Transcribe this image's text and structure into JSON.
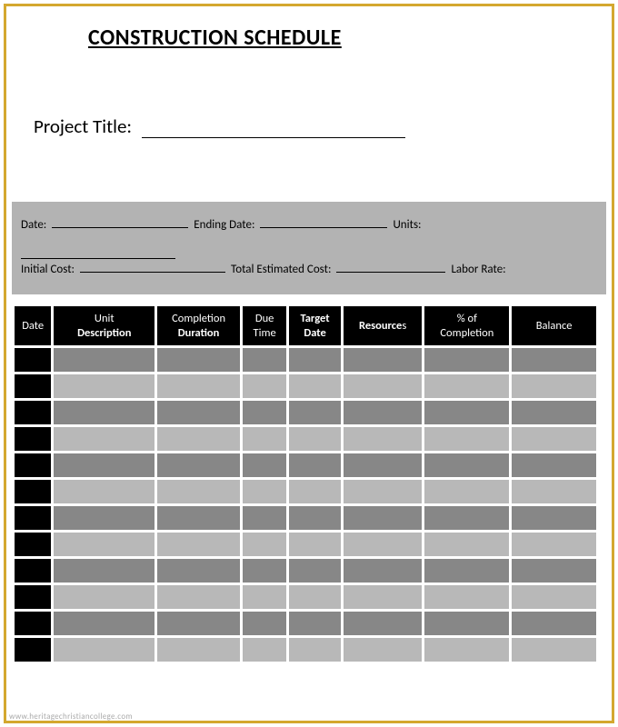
{
  "title": "CONSTRUCTION SCHEDULE",
  "project_title_label": "Project Title:",
  "info": {
    "date_label": "Date:",
    "ending_date_label": "Ending Date:",
    "units_label": "Units:",
    "initial_cost_label": "Initial Cost:",
    "total_estimated_label": "Total Estimated Cost:",
    "labor_rate_label": "Labor Rate:"
  },
  "columns": {
    "date": "Date",
    "unit_desc_l1": "Unit",
    "unit_desc_l2": "Description",
    "completion_l1": "Completion",
    "completion_l2": "Duration",
    "due_l1": "Due",
    "due_l2": "Time",
    "target_l1": "Target",
    "target_l2": "Date",
    "resources_l1": "Resource",
    "resources_l2": "s",
    "pct_l1": "% of",
    "pct_l2": "Completion",
    "balance": "Balance"
  },
  "row_count": 12,
  "watermark": "www.heritagechristiancollege.com"
}
